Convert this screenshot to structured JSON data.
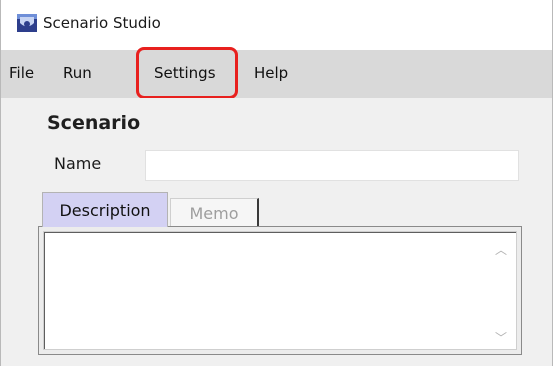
{
  "window": {
    "title": "Scenario Studio",
    "icon": "app-icon"
  },
  "menu": {
    "items": [
      {
        "label": "File"
      },
      {
        "label": "Run"
      },
      {
        "label": "Settings"
      },
      {
        "label": "Help"
      }
    ],
    "highlighted": "Settings",
    "highlight_color": "#e8201e"
  },
  "form": {
    "section_title": "Scenario",
    "name_label": "Name",
    "name_value": "",
    "tabs": [
      {
        "label": "Description",
        "active": true
      },
      {
        "label": "Memo",
        "active": false
      }
    ],
    "description_text": "",
    "active_tab_color": "#d3d1f3"
  }
}
